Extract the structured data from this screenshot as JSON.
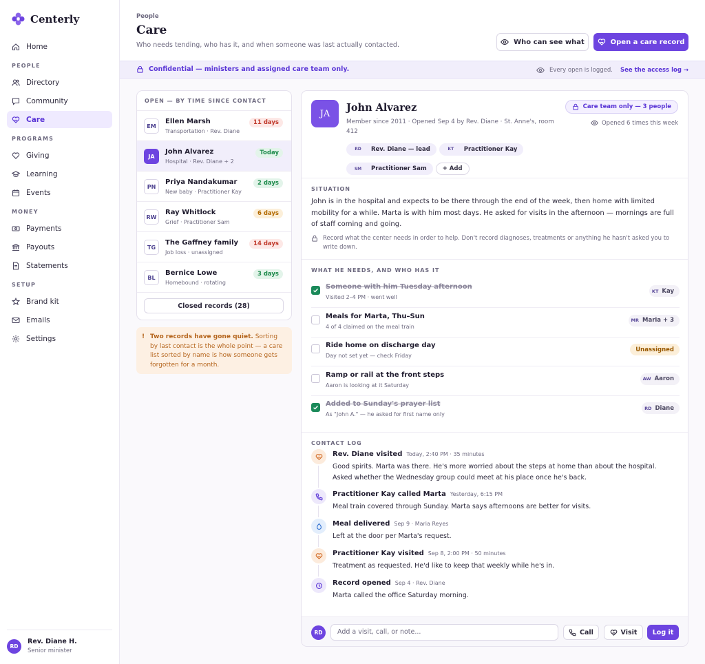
{
  "app": {
    "name": "Centerly"
  },
  "nav": {
    "home": "Home",
    "sections": {
      "people": "PEOPLE",
      "programs": "PROGRAMS",
      "money": "MONEY",
      "setup": "SETUP"
    },
    "directory": "Directory",
    "community": "Community",
    "care": "Care",
    "giving": "Giving",
    "learning": "Learning",
    "events": "Events",
    "payments": "Payments",
    "payouts": "Payouts",
    "statements": "Statements",
    "brand_kit": "Brand kit",
    "emails": "Emails",
    "settings": "Settings"
  },
  "user": {
    "initials": "RD",
    "name": "Rev. Diane H.",
    "role": "Senior minister"
  },
  "header": {
    "breadcrumb": "People",
    "title": "Care",
    "subtitle": "Who needs tending, who has it, and when someone was last actually contacted.",
    "who_can_see": "Who can see what",
    "open_record": "Open a care record"
  },
  "banner": {
    "confidential": "Confidential — ministers and assigned care team only.",
    "logged": "Every open is logged.",
    "access_log": "See the access log →"
  },
  "list": {
    "heading": "OPEN — BY TIME SINCE CONTACT",
    "records": [
      {
        "initials": "EM",
        "name": "Ellen Marsh",
        "meta": "Transportation · Rev. Diane",
        "badge": "11 days",
        "tone": "red"
      },
      {
        "initials": "JA",
        "name": "John Alvarez",
        "meta": "Hospital · Rev. Diane + 2",
        "badge": "Today",
        "tone": "green"
      },
      {
        "initials": "PN",
        "name": "Priya Nandakumar",
        "meta": "New baby · Practitioner Kay",
        "badge": "2 days",
        "tone": "green"
      },
      {
        "initials": "RW",
        "name": "Ray Whitlock",
        "meta": "Grief · Practitioner Sam",
        "badge": "6 days",
        "tone": "amber"
      },
      {
        "initials": "TG",
        "name": "The Gaffney family",
        "meta": "Job loss · unassigned",
        "badge": "14 days",
        "tone": "red"
      },
      {
        "initials": "BL",
        "name": "Bernice Lowe",
        "meta": "Homebound · rotating",
        "badge": "3 days",
        "tone": "green"
      }
    ],
    "closed": "Closed records (28)"
  },
  "warning": {
    "bold": "Two records have gone quiet.",
    "text": "Sorting by last contact is the whole point — a care list sorted by name is how someone gets forgotten for a month."
  },
  "person": {
    "initials": "JA",
    "name": "John Alvarez",
    "meta": "Member since 2011 · Opened Sep 4 by Rev. Diane · St. Anne's, room 412",
    "care_pill": "Care team only — 3 people",
    "opened": "Opened 6 times this week",
    "team": [
      {
        "initials": "RD",
        "label": "Rev. Diane — lead"
      },
      {
        "initials": "KT",
        "label": "Practitioner Kay"
      },
      {
        "initials": "SM",
        "label": "Practitioner Sam"
      }
    ],
    "add": "+ Add"
  },
  "situation": {
    "heading": "SITUATION",
    "text": "John is in the hospital and expects to be there through the end of the week, then home with limited mobility for a while. Marta is with him most days. He asked for visits in the afternoon — mornings are full of staff coming and going.",
    "note": "Record what the center needs in order to help. Don't record diagnoses, treatments or anything he hasn't asked you to write down."
  },
  "needs": {
    "heading": "WHAT HE NEEDS, AND WHO HAS IT",
    "items": [
      {
        "title": "Someone with him Tuesday afternoon",
        "sub": "Visited 2–4 PM · went well",
        "done": true,
        "owner_initials": "KT",
        "owner": "Kay"
      },
      {
        "title": "Meals for Marta, Thu–Sun",
        "sub": "4 of 4 claimed on the meal train",
        "done": false,
        "owner_initials": "MR",
        "owner": "Maria + 3"
      },
      {
        "title": "Ride home on discharge day",
        "sub": "Day not set yet — check Friday",
        "done": false,
        "owner_initials": "",
        "owner": "Unassigned"
      },
      {
        "title": "Ramp or rail at the front steps",
        "sub": "Aaron is looking at it Saturday",
        "done": false,
        "owner_initials": "AW",
        "owner": "Aaron"
      },
      {
        "title": "Added to Sunday's prayer list",
        "sub": "As \"John A.\" — he asked for first name only",
        "done": true,
        "owner_initials": "RD",
        "owner": "Diane"
      }
    ]
  },
  "contact_log": {
    "heading": "CONTACT LOG",
    "entries": [
      {
        "title": "Rev. Diane visited",
        "when": "Today, 2:40 PM · 35 minutes",
        "body": "Good spirits. Marta was there. He's more worried about the steps at home than about the hospital. Asked whether the Wednesday group could meet at his place once he's back.",
        "icon": "heart-hands-icon"
      },
      {
        "title": "Practitioner Kay called Marta",
        "when": "Yesterday, 6:15 PM",
        "body": "Meal train covered through Sunday. Marta says afternoons are better for visits.",
        "icon": "phone-icon"
      },
      {
        "title": "Meal delivered",
        "when": "Sep 9 · Maria Reyes",
        "body": "Left at the door per Marta's request.",
        "icon": "meal-icon"
      },
      {
        "title": "Practitioner Kay visited",
        "when": "Sep 8, 2:00 PM · 50 minutes",
        "body": "Treatment as requested. He'd like to keep that weekly while he's in.",
        "icon": "heart-hands-icon"
      },
      {
        "title": "Record opened",
        "when": "Sep 4 · Rev. Diane",
        "body": "Marta called the office Saturday morning.",
        "icon": "clock-icon"
      }
    ]
  },
  "composer": {
    "initials": "RD",
    "placeholder": "Add a visit, call, or note...",
    "call": "Call",
    "visit": "Visit",
    "log_it": "Log it"
  },
  "colors": {
    "accent": "#6d44e0",
    "success": "#1b8a5a",
    "warning": "#b5651d",
    "danger": "#c0392b"
  }
}
